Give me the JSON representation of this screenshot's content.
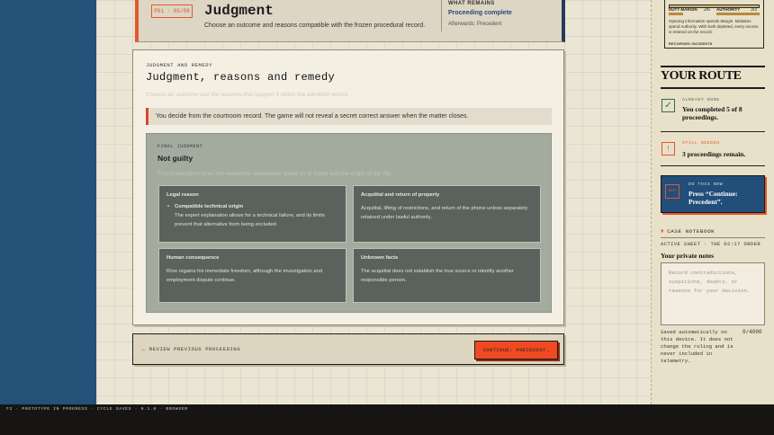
{
  "header": {
    "stamp": "P01 · 05/08",
    "title": "Judgment",
    "subtitle": "Choose an outcome and reasons compatible with the frozen procedural record.",
    "remains_label": "WHAT REMAINS",
    "remains_value": "Proceeding complete",
    "remains_note": "Afterwards: Precedent"
  },
  "panel": {
    "eyebrow": "JUDGMENT AND REMEDY",
    "title": "Judgment, reasons and remedy",
    "faint_text": "Choose an outcome and the reasons that support it within the admitted record.",
    "notice": "You decide from the courtroom record. The game will not reveal a secret correct answer when the matter closes.",
    "judgment": {
      "label": "FINAL JUDGMENT",
      "verdict": "Not guilty",
      "faint_text": "The prosecution does not overcome reasonable doubt as to intent and the origin of the file.",
      "tiles": [
        {
          "heading": "Legal reason",
          "bullet_title": "Compatible technical origin",
          "body": "The expert explanation allows for a technical failure, and its limits prevent that alternative from being excluded."
        },
        {
          "heading": "Acquittal and return of property",
          "body": "Acquittal, lifting of restrictions, and return of the phone unless separately retained under lawful authority."
        },
        {
          "heading": "Human consequence",
          "body": "Ríos regains his immediate freedom, although the investigation and employment dispute continue."
        },
        {
          "heading": "Unknown facts",
          "body": "The acquittal does not establish the true source or identify another responsible person."
        }
      ]
    }
  },
  "nav": {
    "back_label": "← REVIEW PREVIOUS PROCEEDING",
    "continue_label": "CONTINUE: PRECEDENT→"
  },
  "meter": {
    "duty_label": "DUTY MARGIN",
    "duty_value": "2/6",
    "authority_label": "AUTHORITY",
    "authority_value": "3/3",
    "duty_level": 0.33,
    "authority_level": 1.0,
    "text": "Opening information spends Margin. Mistakes spend Authority. With both depleted, every excess is entered on the record.",
    "footer": "RECORDED INCIDENTS"
  },
  "route": {
    "title": "YOUR ROUTE",
    "done_label": "ALREADY DONE",
    "done_value": "You completed 5 of 8 proceedings.",
    "needed_label": "STILL NEEDED",
    "needed_value": "3 proceedings remain.",
    "next_label": "DO THIS NOW",
    "next_value": "Press “Continue: Precedent”.",
    "next_icon": "NEXT"
  },
  "notebook": {
    "heading": "CASE NOTEBOOK",
    "sheet": "ACTIVE SHEET · THE 02:17 ORDER",
    "private_label": "Your private notes",
    "placeholder": "Record contradictions, suspicions, doubts, or reasons for your decision.",
    "saved_text": "Saved automatically on this device. It does not change the ruling and is never included in telemetry.",
    "count": "0/4000"
  },
  "footer": {
    "text": "F2 · PROTOTYPE IN PROGRESS · CYCLE SAVES · 0.1.0 · BROWSER"
  },
  "colors": {
    "accent": "#e4572e",
    "navy": "#235178",
    "panel_green": "#a3ab9f",
    "tile": "#5a625d"
  }
}
